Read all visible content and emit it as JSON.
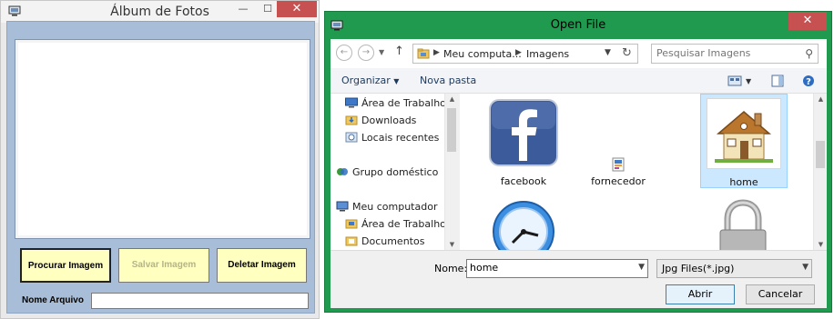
{
  "album": {
    "title": "Álbum de Fotos",
    "minimize": "—",
    "maximize": "☐",
    "close": "✕",
    "buttons": {
      "procurar": "Procurar Imagem",
      "salvar": "Salvar Imagem",
      "deletar": "Deletar Imagem"
    },
    "name_label": "Nome Arquivo",
    "name_value": ""
  },
  "dialog": {
    "title": "Open File",
    "close": "✕",
    "breadcrumb": [
      "Meu computa...",
      "Imagens"
    ],
    "search_placeholder": "Pesquisar Imagens",
    "toolbar": {
      "organize": "Organizar",
      "new_folder": "Nova pasta"
    },
    "tree": [
      {
        "label": "Área de Trabalho",
        "icon": "desktop-icon"
      },
      {
        "label": "Downloads",
        "icon": "downloads-folder-icon"
      },
      {
        "label": "Locais recentes",
        "icon": "recent-places-icon"
      },
      {
        "label": "Grupo doméstico",
        "icon": "homegroup-icon"
      },
      {
        "label": "Meu computador",
        "icon": "computer-icon"
      },
      {
        "label": "Área de Trabalho",
        "icon": "desktop-folder-icon"
      },
      {
        "label": "Documentos",
        "icon": "documents-folder-icon"
      }
    ],
    "files": [
      {
        "label": "facebook",
        "icon": "facebook-logo-icon"
      },
      {
        "label": "fornecedor",
        "icon": "image-file-icon"
      },
      {
        "label": "home",
        "icon": "house-icon",
        "selected": true
      },
      {
        "label": "",
        "icon": "clock-icon"
      },
      {
        "label": "",
        "icon": "padlock-icon"
      }
    ],
    "file_name_label": "Nome:",
    "file_name_value": "home",
    "filter_value": "Jpg Files(*.jpg)",
    "open_button": "Abrir",
    "cancel_button": "Cancelar"
  },
  "colors": {
    "album_body": "#a8bed8",
    "yellow_button": "#ffffc0",
    "dialog_frame": "#1f9a4f",
    "close_red": "#c75050",
    "selection": "#cce8ff"
  }
}
